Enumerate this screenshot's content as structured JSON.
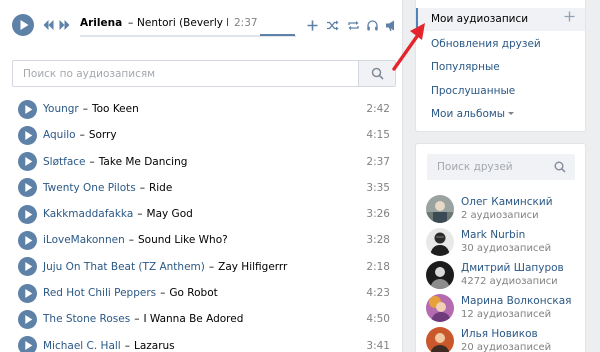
{
  "player": {
    "artist": "Arilena ...",
    "separator": "–",
    "title": "Nentori (Beverly Pills...",
    "time": "2:37",
    "progress": 0.0
  },
  "search": {
    "placeholder": "Поиск по аудиозаписям"
  },
  "tracks": [
    {
      "artist": "Youngr",
      "title": "Too Keen",
      "duration": "2:42"
    },
    {
      "artist": "Aquilo",
      "title": "Sorry",
      "duration": "4:15"
    },
    {
      "artist": "Sløtface",
      "title": "Take Me Dancing",
      "duration": "2:37"
    },
    {
      "artist": "Twenty One Pilots",
      "title": "Ride",
      "duration": "3:35"
    },
    {
      "artist": "Kakkmaddafakka",
      "title": "May God",
      "duration": "3:26"
    },
    {
      "artist": "iLoveMakonnen",
      "title": "Sound Like Who?",
      "duration": "3:28"
    },
    {
      "artist": "Juju On That Beat (TZ Anthem)",
      "title": "Zay Hilfigerrr",
      "duration": "2:18"
    },
    {
      "artist": "Red Hot Chili Peppers",
      "title": "Go Robot",
      "duration": "4:23"
    },
    {
      "artist": "The Stone Roses",
      "title": "I Wanna Be Adored",
      "duration": "4:50"
    },
    {
      "artist": "Michael C. Hall",
      "title": "Lazarus",
      "duration": "3:41"
    }
  ],
  "menu": {
    "items": [
      {
        "label": "Мои аудиозаписи"
      },
      {
        "label": "Обновления друзей"
      },
      {
        "label": "Популярные"
      },
      {
        "label": "Прослушанные"
      },
      {
        "label": "Мои альбомы"
      }
    ]
  },
  "friends": {
    "search_placeholder": "Поиск друзей",
    "items": [
      {
        "name": "Олег Каминский",
        "count": "2 аудиозаписи"
      },
      {
        "name": "Mark Nurbin",
        "count": "30 аудиозаписей"
      },
      {
        "name": "Дмитрий Шапуров",
        "count": "4272 аудиозаписи"
      },
      {
        "name": "Марина Волконская",
        "count": "12 аудиозаписей"
      },
      {
        "name": "Илья Новиков",
        "count": "20 аудиозаписей"
      }
    ]
  },
  "colors": {
    "accent": "#5e81a8",
    "link": "#2a5885",
    "arrow": "#e3262d"
  }
}
